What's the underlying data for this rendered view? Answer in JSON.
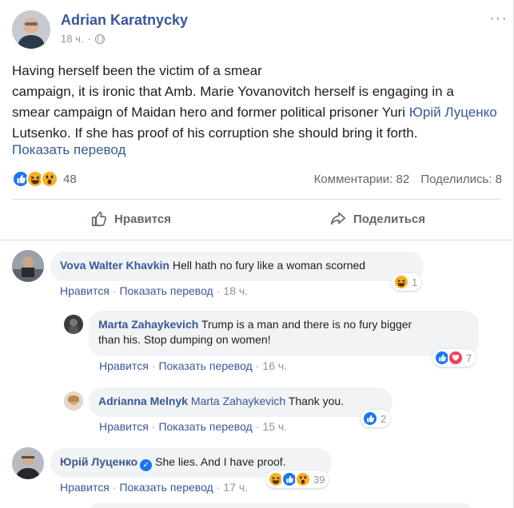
{
  "post": {
    "author": "Adrian Karatnycky",
    "time": "18 ч.",
    "text_lines": [
      "Having herself been the victim of a smear",
      "campaign, it is ironic that Amb. Marie Yovanovitch herself is engaging in a",
      "smear campaign of Maidan hero and former political prisoner Yuri ",
      "Юрій Луценко",
      " Lutsenko. If she has proof of his corruption she should bring it forth."
    ],
    "translate": "Показать перевод",
    "reaction_count": "48",
    "comments_label": "Комментарии: 82",
    "shares_label": "Поделились: 8",
    "like_action": "Нравится",
    "share_action": "Поделиться"
  },
  "comments": [
    {
      "name": "Vova Walter Khavkin",
      "text": "Hell hath no fury like a woman scorned",
      "like": "Нравится",
      "translate": "Показать перевод",
      "time": "18 ч.",
      "reaction_count": "1"
    },
    {
      "name": "Marta Zahaykevich",
      "text_line1": "Trump is a man and there is no fury bigger",
      "text_line2": "than his. Stop dumping on women!",
      "like": "Нравится",
      "translate": "Показать перевод",
      "time": "16 ч.",
      "reaction_count": "7"
    },
    {
      "name": "Adrianna Melnyk",
      "mention": "Marta Zahaykevich",
      "text": "Thank you.",
      "like": "Нравится",
      "translate": "Показать перевод",
      "time": "15 ч.",
      "reaction_count": "2"
    },
    {
      "name": "Юрій Луценко",
      "text": "She lies. And I have proof.",
      "like": "Нравится",
      "translate": "Показать перевод",
      "time": "17 ч.",
      "reaction_count": "39"
    }
  ],
  "colors": {
    "link": "#385898",
    "meta": "#90949c",
    "bubble": "#f2f3f5",
    "like_blue": "#1877f2",
    "haha_yellow": "#f7b125",
    "love_red": "#f33e58"
  },
  "icons": [
    "globe-icon",
    "more-options-icon",
    "thumbs-up-icon",
    "share-arrow-icon",
    "like-reaction-icon",
    "haha-reaction-icon",
    "wow-reaction-icon",
    "love-reaction-icon",
    "verified-badge-icon"
  ]
}
